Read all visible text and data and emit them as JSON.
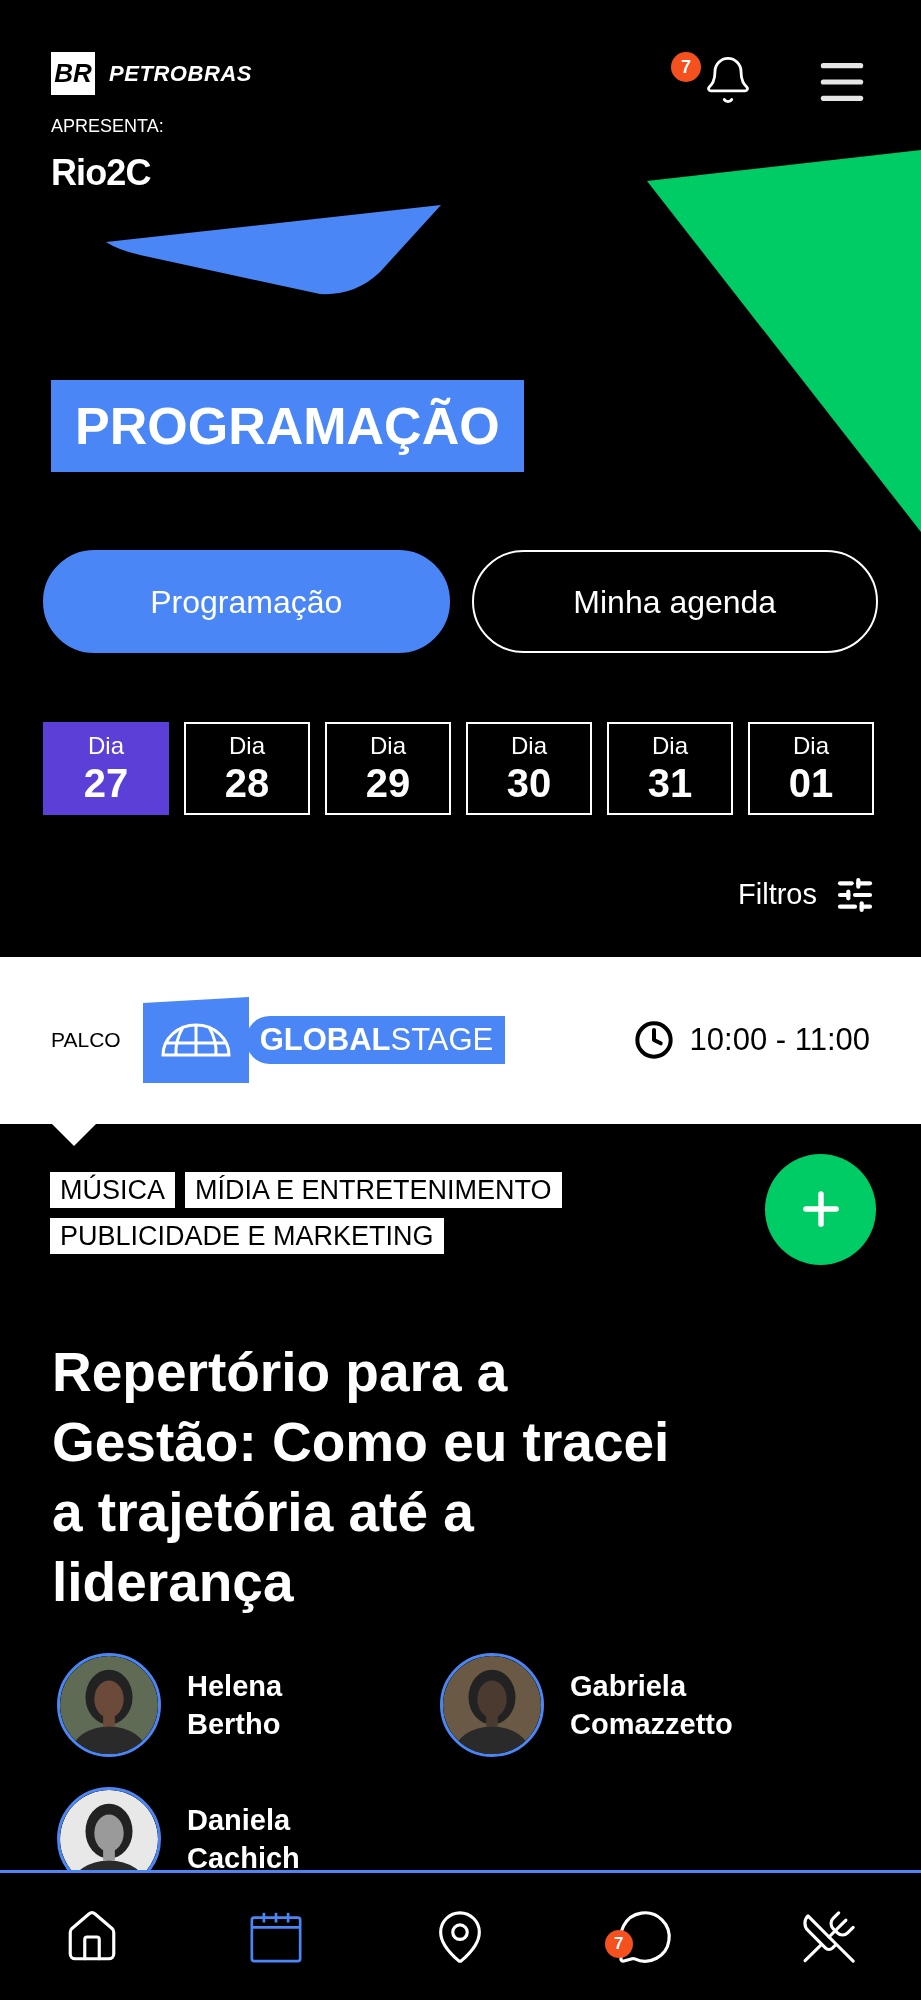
{
  "header": {
    "brand_mark": "BR",
    "brand": "PETROBRAS",
    "presents": "APRESENTA:",
    "event_logo": "Rio2C",
    "notifications": "7"
  },
  "page_title": "PROGRAMAÇÃO",
  "tabs": [
    {
      "label": "Programação",
      "selected": true
    },
    {
      "label": "Minha agenda",
      "selected": false
    }
  ],
  "days": [
    {
      "label": "Dia",
      "day": "27",
      "selected": true
    },
    {
      "label": "Dia",
      "day": "28",
      "selected": false
    },
    {
      "label": "Dia",
      "day": "29",
      "selected": false
    },
    {
      "label": "Dia",
      "day": "30",
      "selected": false
    },
    {
      "label": "Dia",
      "day": "31",
      "selected": false
    },
    {
      "label": "Dia",
      "day": "01",
      "selected": false
    }
  ],
  "filters": "Filtros",
  "session": {
    "stage_label": "PALCO",
    "stage_name": "**GLOBAL**STAGE",
    "time": "10:00 - 11:00",
    "tags": [
      "MÚSICA",
      "MÍDIA E ENTRETENIMENTO",
      "PUBLICIDADE E MARKETING"
    ],
    "title": "Repertório para a Gestão: Como eu tracei a trajetória até a liderança",
    "speakers": [
      {
        "first": "Helena",
        "last": "Bertho"
      },
      {
        "first": "Gabriela",
        "last": "Comazzetto"
      },
      {
        "first": "Daniela",
        "last": "Cachich"
      }
    ]
  },
  "nav": [
    {
      "kind": "home",
      "selected": false
    },
    {
      "kind": "calendar",
      "selected": true
    },
    {
      "kind": "map",
      "selected": false
    },
    {
      "kind": "chat",
      "selected": false,
      "badge": "7"
    },
    {
      "kind": "food",
      "selected": false
    }
  ]
}
